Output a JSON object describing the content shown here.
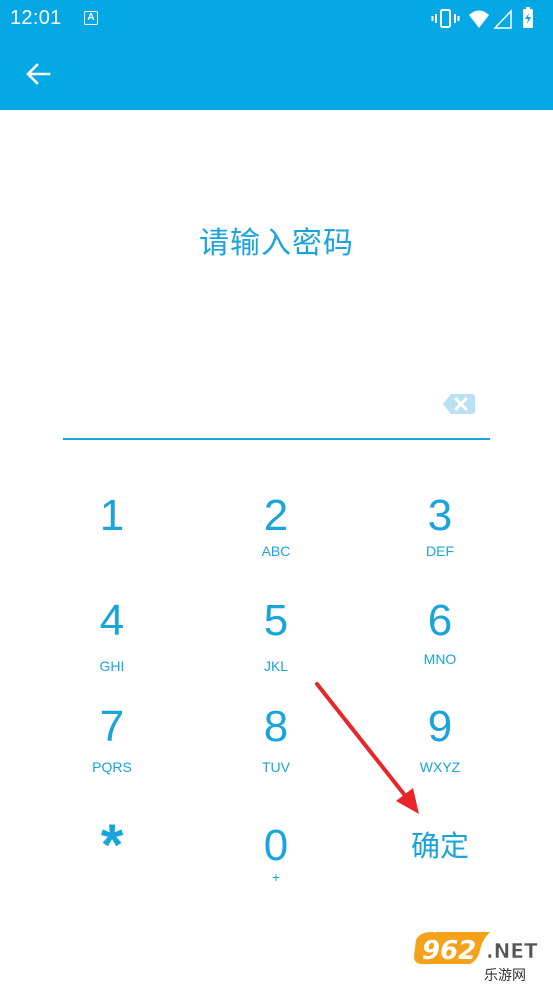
{
  "status_bar": {
    "time": "12:01",
    "notification_icon": "a-badge-icon",
    "icons": [
      "vibrate-icon",
      "wifi-icon",
      "signal-icon",
      "battery-charging-icon"
    ]
  },
  "app_bar": {
    "back_icon": "arrow-left-icon"
  },
  "title": "请输入密码",
  "password_field": {
    "value": "",
    "clear_icon": "backspace-icon"
  },
  "keypad": [
    {
      "digit": "1",
      "letters": ""
    },
    {
      "digit": "2",
      "letters": "ABC"
    },
    {
      "digit": "3",
      "letters": "DEF"
    },
    {
      "digit": "4",
      "letters": "GHI"
    },
    {
      "digit": "5",
      "letters": "JKL"
    },
    {
      "digit": "6",
      "letters": "MNO"
    },
    {
      "digit": "7",
      "letters": "PQRS"
    },
    {
      "digit": "8",
      "letters": "TUV"
    },
    {
      "digit": "9",
      "letters": "WXYZ"
    },
    {
      "digit": "*",
      "letters": ""
    },
    {
      "digit": "0",
      "letters": "+"
    },
    {
      "confirm_label": "确定"
    }
  ],
  "annotation": {
    "arrow_color": "#e8262a"
  },
  "watermark": {
    "text": "962.NET",
    "subtext": "乐游网"
  },
  "colors": {
    "primary": "#03a8e5",
    "accent_text": "#1aa4dc",
    "background": "#ffffff"
  }
}
